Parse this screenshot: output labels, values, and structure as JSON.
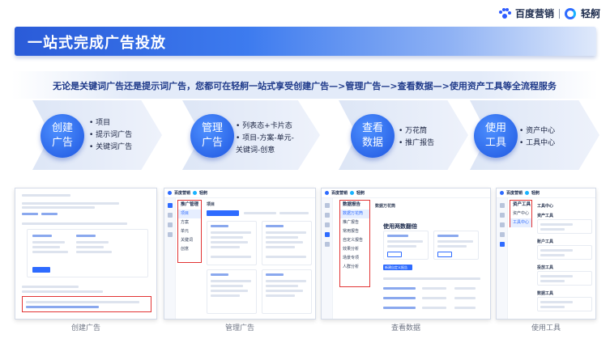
{
  "brand": {
    "name1": "百度营销",
    "name2": "轻舸"
  },
  "title": "一站式完成广告投放",
  "description": "无论是关键词广告还是提示词广告，您都可在轻舸一站式享受创建广告—>管理广告—>查看数据—>使用资产工具等全流程服务",
  "stages": [
    {
      "circle": [
        "创建",
        "广告"
      ],
      "bullets": [
        "项目",
        "提示词广告",
        "关键词广告"
      ],
      "caption": "创建广告"
    },
    {
      "circle": [
        "管理",
        "广告"
      ],
      "bullets": [
        "列表态+卡片态",
        "项目-方案-单元-关键词-创意"
      ],
      "caption": "管理广告"
    },
    {
      "circle": [
        "查看",
        "数据"
      ],
      "bullets": [
        "万花筒",
        "推广报告"
      ],
      "caption": "查看数据"
    },
    {
      "circle": [
        "使用",
        "工具"
      ],
      "bullets": [
        "资产中心",
        "工具中心"
      ],
      "caption": "使用工具"
    }
  ],
  "shots": {
    "manage": {
      "menu_head": "推广管理",
      "items": [
        "项目",
        "方案",
        "单元",
        "关键词",
        "创意"
      ],
      "page_title": "项目"
    },
    "data": {
      "menu_head": "数据报告",
      "items": [
        "数据万花筒",
        "推广报告",
        "常用报告",
        "自定义报告",
        "效果分析",
        "场景专项",
        "人群分析"
      ],
      "page_title": "数据万花筒",
      "heading": "使用两数翻倍",
      "button": "新建自定义报告"
    },
    "tools": {
      "menu_head": "资产工具",
      "items": [
        "资产中心",
        "工具中心"
      ],
      "page_title": "工具中心",
      "sections": [
        "资产工具",
        "账户工具",
        "投放工具",
        "数据工具"
      ]
    }
  }
}
